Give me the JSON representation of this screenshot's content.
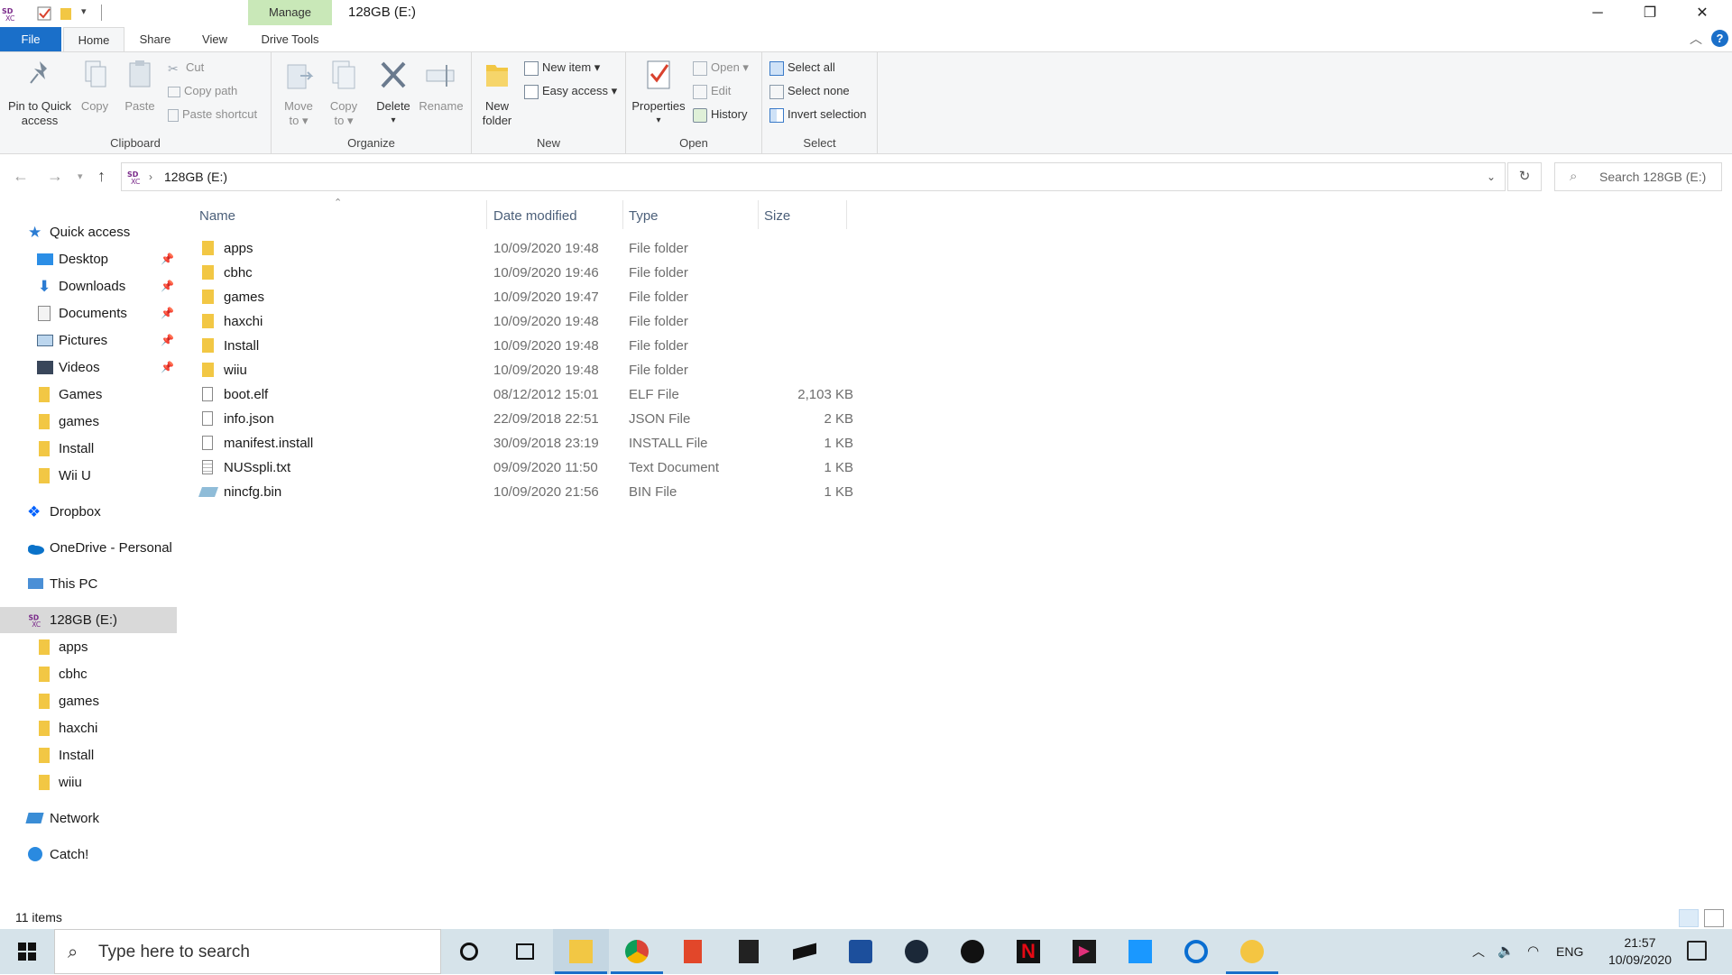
{
  "titlebar": {
    "manage_label": "Manage",
    "title": "128GB (E:)"
  },
  "tabs": {
    "file": "File",
    "home": "Home",
    "share": "Share",
    "view": "View",
    "drive_tools": "Drive Tools"
  },
  "ribbon": {
    "clipboard": {
      "label": "Clipboard",
      "pin_line1": "Pin to Quick",
      "pin_line2": "access",
      "copy": "Copy",
      "paste": "Paste",
      "cut": "Cut",
      "copy_path": "Copy path",
      "paste_shortcut": "Paste shortcut"
    },
    "organize": {
      "label": "Organize",
      "move_line1": "Move",
      "move_line2": "to",
      "copyto_line1": "Copy",
      "copyto_line2": "to",
      "delete": "Delete",
      "rename": "Rename"
    },
    "new": {
      "label": "New",
      "new_folder_line1": "New",
      "new_folder_line2": "folder",
      "new_item": "New item",
      "easy_access": "Easy access"
    },
    "open": {
      "label": "Open",
      "properties": "Properties",
      "open": "Open",
      "edit": "Edit",
      "history": "History"
    },
    "select": {
      "label": "Select",
      "select_all": "Select all",
      "select_none": "Select none",
      "invert_selection": "Invert selection"
    }
  },
  "address": {
    "path": "128GB (E:)",
    "search_placeholder": "Search 128GB (E:)"
  },
  "nav": {
    "quick_access": "Quick access",
    "quick_items": [
      {
        "label": "Desktop"
      },
      {
        "label": "Downloads"
      },
      {
        "label": "Documents"
      },
      {
        "label": "Pictures"
      },
      {
        "label": "Videos"
      },
      {
        "label": "Games"
      },
      {
        "label": "games"
      },
      {
        "label": "Install"
      },
      {
        "label": "Wii U"
      }
    ],
    "dropbox": "Dropbox",
    "onedrive": "OneDrive - Personal",
    "this_pc": "This PC",
    "drive": "128GB (E:)",
    "drive_items": [
      {
        "label": "apps"
      },
      {
        "label": "cbhc"
      },
      {
        "label": "games"
      },
      {
        "label": "haxchi"
      },
      {
        "label": "Install"
      },
      {
        "label": "wiiu"
      }
    ],
    "network": "Network",
    "catch": "Catch!"
  },
  "columns": {
    "name": "Name",
    "date_modified": "Date modified",
    "type": "Type",
    "size": "Size"
  },
  "files": [
    {
      "name": "apps",
      "date": "10/09/2020 19:48",
      "type": "File folder",
      "size": ""
    },
    {
      "name": "cbhc",
      "date": "10/09/2020 19:46",
      "type": "File folder",
      "size": ""
    },
    {
      "name": "games",
      "date": "10/09/2020 19:47",
      "type": "File folder",
      "size": ""
    },
    {
      "name": "haxchi",
      "date": "10/09/2020 19:48",
      "type": "File folder",
      "size": ""
    },
    {
      "name": "Install",
      "date": "10/09/2020 19:48",
      "type": "File folder",
      "size": ""
    },
    {
      "name": "wiiu",
      "date": "10/09/2020 19:48",
      "type": "File folder",
      "size": ""
    },
    {
      "name": "boot.elf",
      "date": "08/12/2012 15:01",
      "type": "ELF File",
      "size": "2,103 KB"
    },
    {
      "name": "info.json",
      "date": "22/09/2018 22:51",
      "type": "JSON File",
      "size": "2 KB"
    },
    {
      "name": "manifest.install",
      "date": "30/09/2018 23:19",
      "type": "INSTALL File",
      "size": "1 KB"
    },
    {
      "name": "NUSspli.txt",
      "date": "09/09/2020 11:50",
      "type": "Text Document",
      "size": "1 KB"
    },
    {
      "name": "nincfg.bin",
      "date": "10/09/2020 21:56",
      "type": "BIN File",
      "size": "1 KB"
    }
  ],
  "status": {
    "item_count": "11 items"
  },
  "taskbar": {
    "search_placeholder": "Type here to search",
    "lang": "ENG",
    "time": "21:57",
    "date": "10/09/2020"
  },
  "colors": {
    "accent": "#1a6fc9",
    "folder": "#f2c744",
    "manage_tab": "#c9e8b8",
    "taskbar": "#d6e3ea"
  }
}
